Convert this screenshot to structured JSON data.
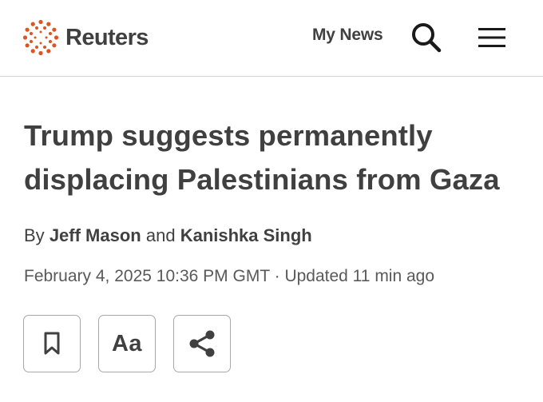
{
  "header": {
    "brand": "Reuters",
    "my_news_label": "My News",
    "search_icon": "search-icon",
    "menu_icon": "hamburger-menu-icon",
    "brand_color": "#dc5522"
  },
  "article": {
    "title": "Trump suggests permanently displacing Palestinians from Gaza",
    "byline_prefix": "By",
    "author_1": "Jeff Mason",
    "byline_conjunction": "and",
    "author_2": "Kanishka Singh",
    "published": "February 4, 2025 10:36 PM GMT",
    "separator": "·",
    "updated": "Updated 11 min ago"
  },
  "actions": {
    "bookmark_icon": "bookmark-icon",
    "text_size_label": "Aa",
    "share_icon": "share-icon"
  }
}
